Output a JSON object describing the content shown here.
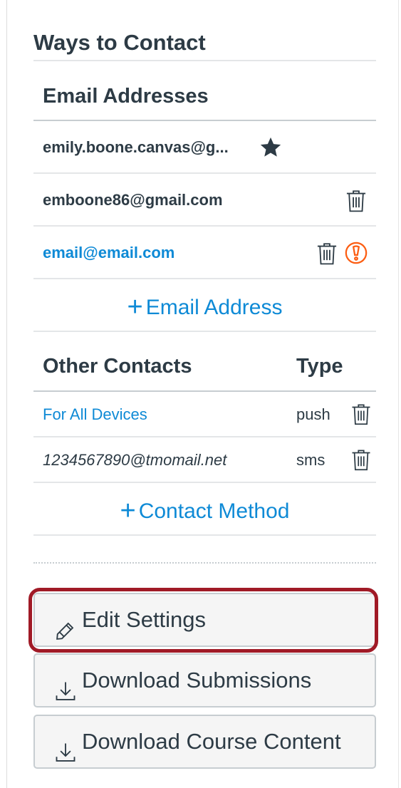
{
  "ways_to_contact": {
    "title": "Ways to Contact",
    "email_section": {
      "heading": "Email Addresses",
      "emails": [
        {
          "address": "emily.boone.canvas@g...",
          "icon": "star-icon",
          "style": "default"
        },
        {
          "address": "emboone86@gmail.com",
          "icon": "trash-icon",
          "style": "default"
        },
        {
          "address": "email@email.com",
          "icon": "trash-icon",
          "warning_icon": "warning-icon",
          "style": "link"
        }
      ],
      "add_label": "Email Address"
    },
    "other_contacts": {
      "heading": "Other Contacts",
      "type_heading": "Type",
      "rows": [
        {
          "name": "For All Devices",
          "type": "push",
          "style": "link"
        },
        {
          "name": "1234567890@tmomail.net",
          "type": "sms",
          "style": "italic"
        }
      ],
      "add_label": "Contact Method"
    }
  },
  "buttons": {
    "edit_settings": "Edit Settings",
    "download_submissions": "Download Submissions",
    "download_course_content": "Download Course Content"
  },
  "colors": {
    "link": "#0e8ad6",
    "text": "#2d3b45",
    "warning": "#fc5e13",
    "highlight_border": "#a01a26",
    "button_bg": "#f5f5f5"
  }
}
